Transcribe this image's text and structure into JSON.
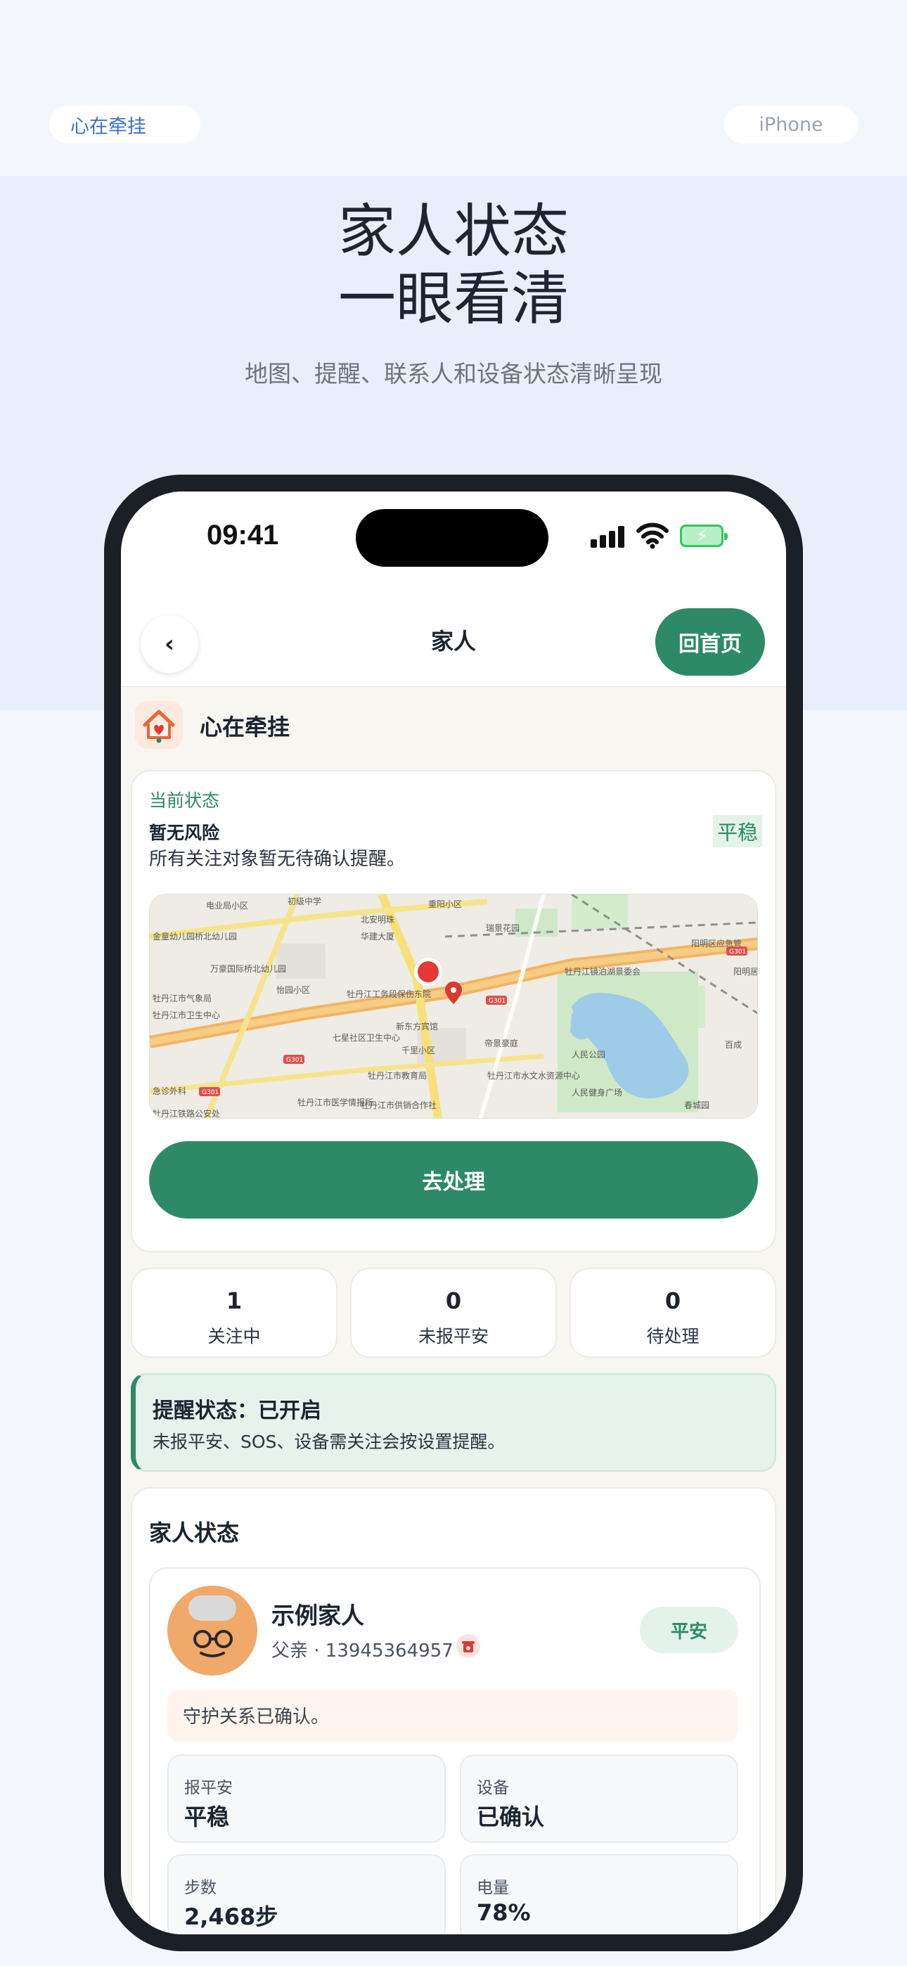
{
  "promo": {
    "tag_left": "心在牵挂",
    "tag_right": "iPhone",
    "headline_line1": "家人状态",
    "headline_line2": "一眼看清",
    "subheadline": "地图、提醒、联系人和设备状态清晰呈现"
  },
  "statusbar": {
    "time": "09:41"
  },
  "navbar": {
    "back": "‹",
    "title": "家人",
    "home_button": "回首页"
  },
  "brand": {
    "name": "心在牵挂"
  },
  "current_status": {
    "label": "当前状态",
    "title": "暂无风险",
    "description": "所有关注对象暂无待确认提醒。",
    "badge": "平稳",
    "action_button": "去处理"
  },
  "map": {
    "labels": [
      "电业局小区",
      "初级中学",
      "重阳小区",
      "北安明珠",
      "华建大厦",
      "瑞景花园",
      "阳明区应急管",
      "金童幼儿园桥北幼儿园",
      "万豪国际桥北幼儿园",
      "牡丹江镜泊湖景委会",
      "阳明居民",
      "牡丹江市气象局",
      "怡园小区",
      "牡丹江工务段保伤东院",
      "牡丹江市卫生中心",
      "七星社区卫生中心",
      "新东方宾馆",
      "千里小区",
      "帝景豪庭",
      "人民公园",
      "百成",
      "牡丹江市教育局",
      "牡丹江市水文水资源中心",
      "人民健身广场",
      "牡丹江市医学情报所",
      "牡丹江市供销合作社",
      "春城园",
      "牡丹江铁路公安处",
      "急诊外科"
    ],
    "road_tags": [
      "G301",
      "G301",
      "G301",
      "G301"
    ]
  },
  "stats": [
    {
      "value": "1",
      "label": "关注中"
    },
    {
      "value": "0",
      "label": "未报平安"
    },
    {
      "value": "0",
      "label": "待处理"
    }
  ],
  "reminder": {
    "title": "提醒状态：已开启",
    "description": "未报平安、SOS、设备需关注会按设置提醒。"
  },
  "family": {
    "section_title": "家人状态",
    "member": {
      "name": "示例家人",
      "relation": "父亲 · 13945364957",
      "status_badge": "平安",
      "note": "守护关系已确认。",
      "tiles": [
        {
          "label": "报平安",
          "value": "平稳"
        },
        {
          "label": "设备",
          "value": "已确认"
        },
        {
          "label": "步数",
          "value": "2,468步"
        },
        {
          "label": "电量",
          "value": "78%"
        }
      ]
    }
  },
  "colors": {
    "primary": "#2e8a66",
    "accent_blue": "#3a72cf",
    "alert_red": "#e53935"
  }
}
